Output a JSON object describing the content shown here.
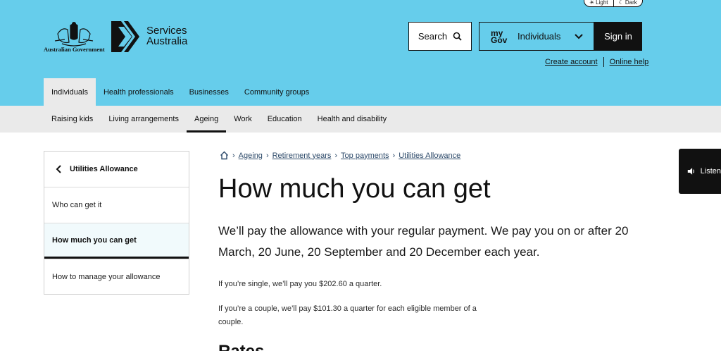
{
  "theme_toggle": {
    "light_label": "Light",
    "dark_label": "Dark"
  },
  "gov_logo_text": "Australian Government",
  "brand": {
    "line1": "Services",
    "line2": "Australia"
  },
  "search": {
    "label": "Search"
  },
  "mygov": {
    "logo_line1": "my",
    "logo_line2": "Gov",
    "label": "Individuals"
  },
  "signin": {
    "label": "Sign in"
  },
  "util_links": {
    "create_account": "Create account",
    "online_help": "Online help"
  },
  "audience_tabs": [
    {
      "label": "Individuals",
      "active": true
    },
    {
      "label": "Health professionals"
    },
    {
      "label": "Businesses"
    },
    {
      "label": "Community groups"
    }
  ],
  "subnav": [
    {
      "label": "Raising kids"
    },
    {
      "label": "Living arrangements"
    },
    {
      "label": "Ageing",
      "active": true
    },
    {
      "label": "Work"
    },
    {
      "label": "Education"
    },
    {
      "label": "Health and disability"
    }
  ],
  "sidebar": {
    "title": "Utilities Allowance",
    "links": [
      {
        "label": "Who can get it"
      },
      {
        "label": "How much you can get",
        "active": true
      },
      {
        "label": "How to manage your allowance"
      }
    ]
  },
  "breadcrumb": [
    "Ageing",
    "Retirement years",
    "Top payments",
    "Utilities Allowance"
  ],
  "page": {
    "title": "How much you can get",
    "lead": "We’ll pay the allowance with your regular payment. We pay you on or after 20 March, 20 June, 20 September and 20 December each year.",
    "para1": "If you’re single, we’ll pay you $202.60 a quarter.",
    "para2": "If you’re a couple, we’ll pay $101.30 a quarter for each eligible member of a couple.",
    "next_heading": "Rates discontinued"
  },
  "listen": {
    "label": "Listen"
  },
  "colors": {
    "header_bg": "#66cdeb",
    "subnav_bg": "#eaeaea",
    "link": "#2d4a6a"
  }
}
